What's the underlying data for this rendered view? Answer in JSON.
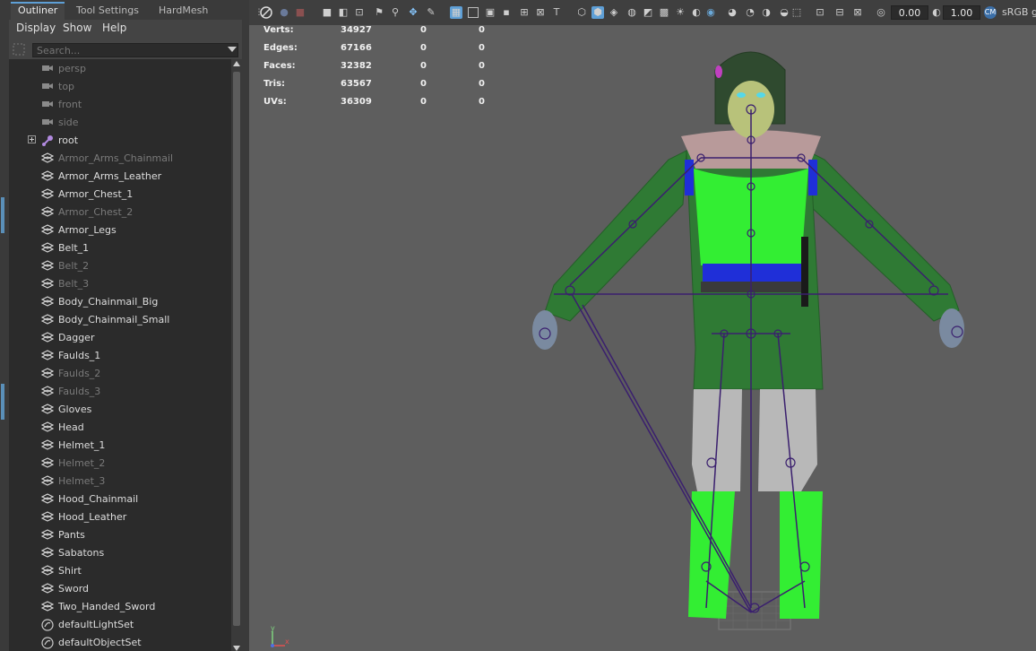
{
  "outliner": {
    "tabs": [
      "Outliner",
      "Tool Settings",
      "HardMesh"
    ],
    "menu": [
      "Display",
      "Show",
      "Help"
    ],
    "search_placeholder": "Search...",
    "items": [
      {
        "label": "persp",
        "icon": "camera-icon",
        "dim": true
      },
      {
        "label": "top",
        "icon": "camera-icon",
        "dim": true
      },
      {
        "label": "front",
        "icon": "camera-icon",
        "dim": true
      },
      {
        "label": "side",
        "icon": "camera-icon",
        "dim": true
      },
      {
        "label": "root",
        "icon": "joint-icon",
        "dim": false,
        "expandable": true
      },
      {
        "label": "Armor_Arms_Chainmail",
        "icon": "mesh-icon",
        "dim": true
      },
      {
        "label": "Armor_Arms_Leather",
        "icon": "mesh-icon",
        "dim": false
      },
      {
        "label": "Armor_Chest_1",
        "icon": "mesh-icon",
        "dim": false
      },
      {
        "label": "Armor_Chest_2",
        "icon": "mesh-icon",
        "dim": true
      },
      {
        "label": "Armor_Legs",
        "icon": "mesh-icon",
        "dim": false
      },
      {
        "label": "Belt_1",
        "icon": "mesh-icon",
        "dim": false
      },
      {
        "label": "Belt_2",
        "icon": "mesh-icon",
        "dim": true
      },
      {
        "label": "Belt_3",
        "icon": "mesh-icon",
        "dim": true
      },
      {
        "label": "Body_Chainmail_Big",
        "icon": "mesh-icon",
        "dim": false
      },
      {
        "label": "Body_Chainmail_Small",
        "icon": "mesh-icon",
        "dim": false
      },
      {
        "label": "Dagger",
        "icon": "mesh-icon",
        "dim": false
      },
      {
        "label": "Faulds_1",
        "icon": "mesh-icon",
        "dim": false
      },
      {
        "label": "Faulds_2",
        "icon": "mesh-icon",
        "dim": true
      },
      {
        "label": "Faulds_3",
        "icon": "mesh-icon",
        "dim": true
      },
      {
        "label": "Gloves",
        "icon": "mesh-icon",
        "dim": false
      },
      {
        "label": "Head",
        "icon": "mesh-icon",
        "dim": false
      },
      {
        "label": "Helmet_1",
        "icon": "mesh-icon",
        "dim": false
      },
      {
        "label": "Helmet_2",
        "icon": "mesh-icon",
        "dim": true
      },
      {
        "label": "Helmet_3",
        "icon": "mesh-icon",
        "dim": true
      },
      {
        "label": "Hood_Chainmail",
        "icon": "mesh-icon",
        "dim": false
      },
      {
        "label": "Hood_Leather",
        "icon": "mesh-icon",
        "dim": false
      },
      {
        "label": "Pants",
        "icon": "mesh-icon",
        "dim": false
      },
      {
        "label": "Sabatons",
        "icon": "mesh-icon",
        "dim": false
      },
      {
        "label": "Shirt",
        "icon": "mesh-icon",
        "dim": false
      },
      {
        "label": "Sword",
        "icon": "mesh-icon",
        "dim": false
      },
      {
        "label": "Two_Handed_Sword",
        "icon": "mesh-icon",
        "dim": false
      },
      {
        "label": "defaultLightSet",
        "icon": "set-icon",
        "dim": false
      },
      {
        "label": "defaultObjectSet",
        "icon": "set-icon",
        "dim": false
      }
    ]
  },
  "toolbar": {
    "field_a": "0.00",
    "field_b": "1.00",
    "color_space": "sRGB g"
  },
  "hud": {
    "rows": [
      {
        "label": "Verts:",
        "v1": "34927",
        "v2": "0",
        "v3": "0"
      },
      {
        "label": "Edges:",
        "v1": "67166",
        "v2": "0",
        "v3": "0"
      },
      {
        "label": "Faces:",
        "v1": "32382",
        "v2": "0",
        "v3": "0"
      },
      {
        "label": "Tris:",
        "v1": "63567",
        "v2": "0",
        "v3": "0"
      },
      {
        "label": "UVs:",
        "v1": "36309",
        "v2": "0",
        "v3": "0"
      }
    ]
  },
  "axis": {
    "y": "y",
    "x": "x"
  },
  "colors": {
    "viewport_bg": "#5e5e5e",
    "tunic": "#2f7a34",
    "shirt": "#33ee33",
    "belt": "#1f2fd8",
    "skeleton": "#3a1f6e",
    "skin": "#b8c27a",
    "hood": "#2f4a2f",
    "accent": "#5e9fd6"
  }
}
